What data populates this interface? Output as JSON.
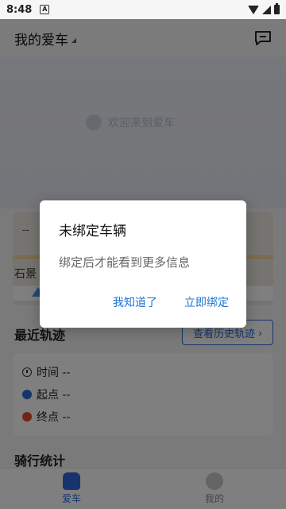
{
  "status_bar": {
    "time": "8:48",
    "notification": "A"
  },
  "header": {
    "title": "我的爱车"
  },
  "hero": {
    "text": "欢迎来到爱车"
  },
  "map": {
    "dash": "--",
    "location_label": "石景"
  },
  "recent_tracks": {
    "title": "最近轨迹",
    "history_button": "查看历史轨迹",
    "rows": [
      {
        "label": "时间 --"
      },
      {
        "label": "起点 --"
      },
      {
        "label": "终点 --"
      }
    ]
  },
  "stats": {
    "title": "骑行统计"
  },
  "bottom_nav": {
    "items": [
      {
        "label": "爱车"
      },
      {
        "label": "我的"
      }
    ]
  },
  "dialog": {
    "title": "未绑定车辆",
    "message": "绑定后才能看到更多信息",
    "cancel_label": "我知道了",
    "confirm_label": "立即绑定"
  },
  "colors": {
    "accent": "#2f6bd8",
    "start_dot": "#2f6bd8",
    "end_dot": "#e24a2a",
    "dialog_button": "#1f74d1"
  }
}
